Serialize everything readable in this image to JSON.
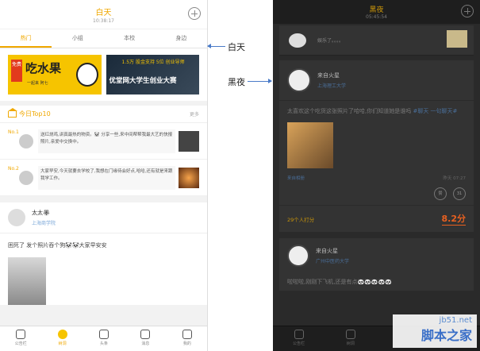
{
  "day": {
    "title": "白天",
    "time": "10:38:17",
    "tabs": [
      {
        "label": "热门",
        "active": true
      },
      {
        "label": "小组",
        "active": false
      },
      {
        "label": "本校",
        "active": false
      },
      {
        "label": "身边",
        "active": false
      }
    ],
    "banner1": {
      "tag": "免费",
      "text": "吃水果",
      "sub": "一起来 阿七"
    },
    "banner2": {
      "top": "1.5万 股金支持 5位 创业导师",
      "main": "优堂网大学生创业大赛"
    },
    "top10": {
      "title": "今日Top10",
      "more": "更多"
    },
    "ranks": [
      {
        "no": "No.1",
        "text": "送红烧鸡,讲真最热的物资。🐼 分享一些,来中间帮帮我最大艺的快报照片,亲爱中交换中。"
      },
      {
        "no": "No.2",
        "text": "大家早安,今天就要去学校了,我想在门缘待会好点,哈哈,还有就是来跟我学工作。"
      }
    ],
    "post": {
      "name": "太太🏵",
      "school": "上海商学院",
      "body": "困死了 发个照片吞个狗🐼🐼大家早安安"
    },
    "nav": [
      {
        "label": "公告栏",
        "active": false
      },
      {
        "label": "树洞",
        "active": true
      },
      {
        "label": "头条",
        "active": false
      },
      {
        "label": "消息",
        "active": false
      },
      {
        "label": "我的",
        "active": false
      }
    ]
  },
  "labels": {
    "day": "白天",
    "night": "黑夜"
  },
  "night": {
    "title": "黑夜",
    "time": "05:45:54",
    "card1": {
      "dots": "娱乐了。。。。"
    },
    "card2": {
      "name": "来自火星",
      "school": "上海理工大学",
      "body": "太喜欢这个吃货这张照片了哈哈,你们知道她是谁吗",
      "tag": "#聊天 一句聊天#",
      "meta_left": "来自相册",
      "meta_right": "昨天 07:27",
      "acts": [
        "赞",
        "31"
      ],
      "count": "29个人打分",
      "score": "8.2分"
    },
    "card3": {
      "name": "来自火星",
      "school": "广州中医药大学",
      "body": "啦啦啦,刚刚下飞机,还是有点🐼🐼🐼🐼🐼"
    },
    "nav": [
      {
        "label": "公告栏",
        "active": false
      },
      {
        "label": "树洞",
        "active": false
      }
    ]
  },
  "watermark": {
    "url": "jb51.net",
    "name": "脚本之家"
  }
}
